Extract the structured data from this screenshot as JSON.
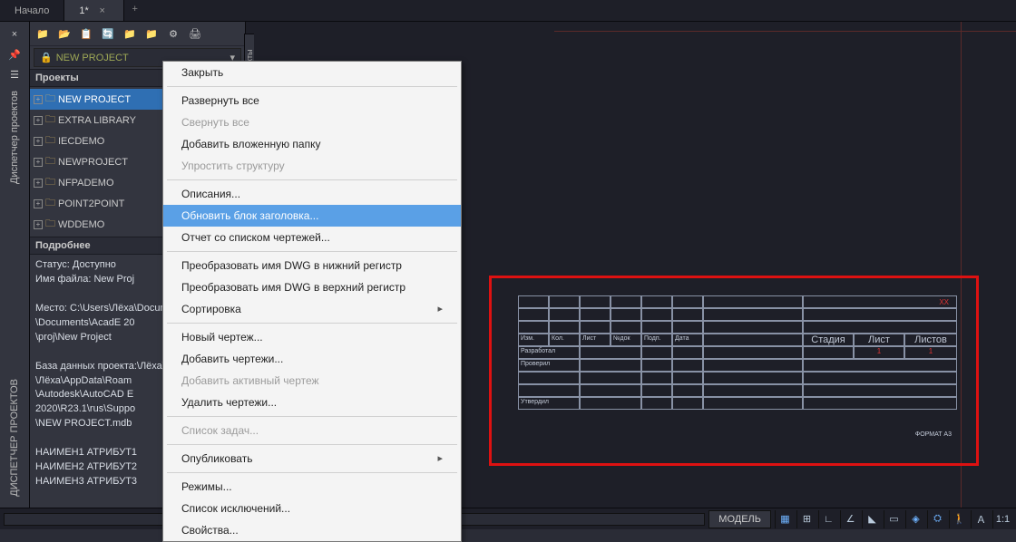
{
  "tabs": {
    "start": "Начало",
    "active": "1*",
    "add": "+"
  },
  "sidebar": {
    "label1": "Диспетчер проектов",
    "label2": "ДИСПЕТЧЕР ПРОЕКТОВ",
    "collapse_label": "кты"
  },
  "toolbar_icons": [
    "new",
    "open",
    "savelist",
    "refresh",
    "folder-arrow",
    "folder",
    "settings",
    "print"
  ],
  "project_selector": {
    "name": "NEW PROJECT"
  },
  "tree_header": "Проекты",
  "tree": [
    {
      "label": "NEW PROJECT",
      "selected": true
    },
    {
      "label": "EXTRA LIBRARY"
    },
    {
      "label": "IECDEMO"
    },
    {
      "label": "NEWPROJECT"
    },
    {
      "label": "NFPADEMO"
    },
    {
      "label": "POINT2POINT"
    },
    {
      "label": "WDDEMO"
    }
  ],
  "details_header": "Подробнее",
  "details": {
    "status": "Статус: Доступно",
    "fname": "Имя файла: New Proj",
    "loc": "Место: C:\\Users\\Лёха\\Documents\\AcadE 20\\proj\\New Project",
    "db": "База данных проекта:\\Лёха\\AppData\\Roam\\Autodesk\\AutoCAD E\\2020\\R23.1\\rus\\Suppo\\NEW PROJECT.mdb",
    "a1": "НАИМЕН1 АТРИБУТ1",
    "a2": "НАИМЕН2 АТРИБУТ2",
    "a3": "НАИМЕН3 АТРИБУТ3"
  },
  "context_menu": [
    {
      "label": "Закрыть"
    },
    {
      "sep": true
    },
    {
      "label": "Развернуть все"
    },
    {
      "label": "Свернуть все",
      "disabled": true
    },
    {
      "label": "Добавить вложенную папку"
    },
    {
      "label": "Упростить структуру",
      "disabled": true
    },
    {
      "sep": true
    },
    {
      "label": "Описания..."
    },
    {
      "label": "Обновить блок заголовка...",
      "highlight": true
    },
    {
      "label": "Отчет со списком чертежей..."
    },
    {
      "sep": true
    },
    {
      "label": "Преобразовать имя DWG в нижний регистр"
    },
    {
      "label": "Преобразовать имя DWG в верхний регистр"
    },
    {
      "label": "Сортировка",
      "sub": true
    },
    {
      "sep": true
    },
    {
      "label": "Новый чертеж..."
    },
    {
      "label": "Добавить чертежи..."
    },
    {
      "label": "Добавить активный чертеж",
      "disabled": true
    },
    {
      "label": "Удалить чертежи..."
    },
    {
      "sep": true
    },
    {
      "label": "Список задач...",
      "disabled": true
    },
    {
      "sep": true
    },
    {
      "label": "Опубликовать",
      "sub": true
    },
    {
      "sep": true
    },
    {
      "label": "Режимы..."
    },
    {
      "label": "Список исключений..."
    },
    {
      "label": "Свойства..."
    }
  ],
  "title_block": {
    "row_labels": [
      "Изм.",
      "Кол.",
      "Лист",
      "№док",
      "Подп.",
      "Дата"
    ],
    "roles": [
      "Разработал",
      "Проверил",
      "Утвердил"
    ],
    "cols": [
      "Стадия",
      "Лист",
      "Листов"
    ],
    "val1": "1",
    "val2": "1",
    "note": "ХХ",
    "format": "ФОРМАТ А3"
  },
  "status": {
    "model": "МОДЕЛЬ",
    "scale": "1:1"
  },
  "app_badge": "A"
}
